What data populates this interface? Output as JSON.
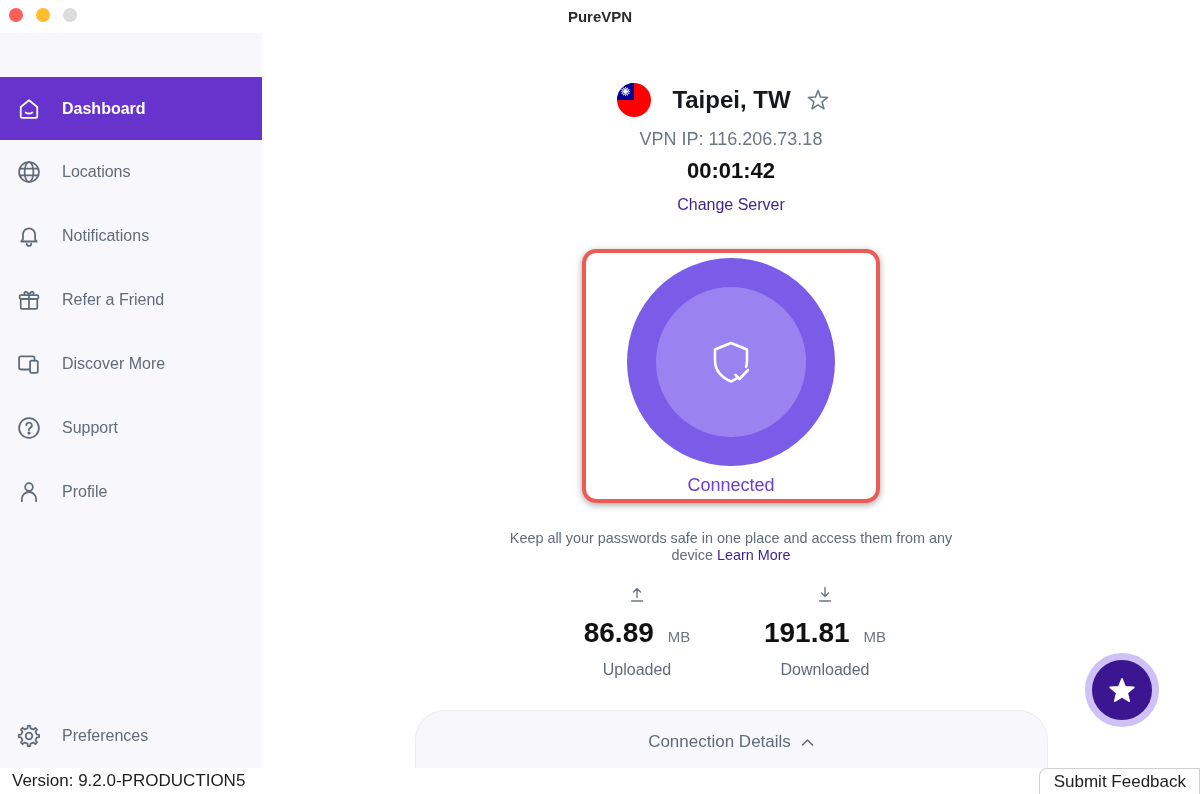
{
  "window": {
    "title": "PureVPN",
    "zoom_enabled": false
  },
  "sidebar": {
    "items": [
      {
        "label": "Dashboard",
        "selected": true
      },
      {
        "label": "Locations",
        "selected": false
      },
      {
        "label": "Notifications",
        "selected": false
      },
      {
        "label": "Refer a Friend",
        "selected": false
      },
      {
        "label": "Discover More",
        "selected": false
      },
      {
        "label": "Support",
        "selected": false
      },
      {
        "label": "Profile",
        "selected": false
      }
    ],
    "bottom_items": [
      {
        "label": "Preferences",
        "selected": false
      }
    ]
  },
  "connection": {
    "location": "Taipei, TW",
    "favorite": false,
    "vpn_ip": "VPN IP: 116.206.73.18",
    "timer": "00:01:42",
    "change_server": "Change Server",
    "status": "Connected"
  },
  "promo": {
    "text": "Keep all your passwords safe in one place and access them from any device",
    "link": "Learn More"
  },
  "traffic": [
    {
      "kind": "upload",
      "value": "86.89",
      "unit": "MB",
      "label": "Uploaded"
    },
    {
      "kind": "download",
      "value": "191.81",
      "unit": "MB",
      "label": "Downloaded"
    }
  ],
  "connection_details": {
    "label": "Connection Details",
    "expanded": false
  },
  "footer": {
    "version": "Version: 9.2.0-PRODUCTION5",
    "feedback_button": "Submit Feedback"
  }
}
